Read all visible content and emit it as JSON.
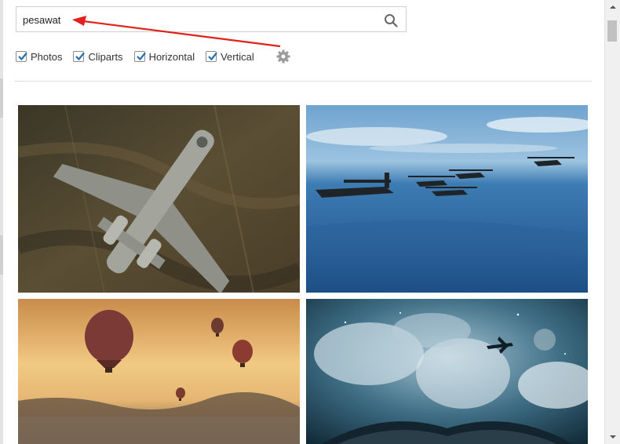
{
  "search": {
    "value": "pesawat",
    "placeholder": ""
  },
  "filters": [
    {
      "label": "Photos",
      "checked": true
    },
    {
      "label": "Cliparts",
      "checked": true
    },
    {
      "label": "Horizontal",
      "checked": true
    },
    {
      "label": "Vertical",
      "checked": true
    }
  ],
  "icons": {
    "search": "search-icon",
    "settings": "gear-icon",
    "checkbox": "checkmark-icon"
  },
  "results": [
    {
      "subject": "military jet aircraft flying over desert"
    },
    {
      "subject": "transport plane refueling helicopters over ocean"
    },
    {
      "subject": "hot air balloons at sunset"
    },
    {
      "subject": "airplane flying over book and clouds"
    }
  ],
  "colors": {
    "accent": "#2271b1",
    "annotation": "#e0201b"
  }
}
